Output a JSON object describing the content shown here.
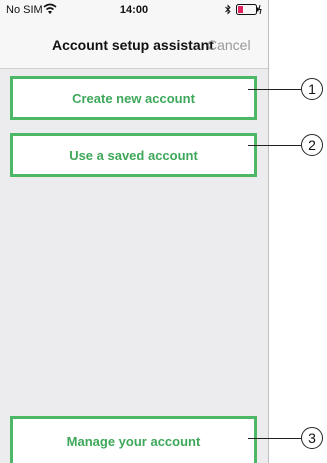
{
  "status_bar": {
    "carrier": "No SIM",
    "time": "14:00"
  },
  "nav_bar": {
    "title": "Account setup assistant",
    "cancel_label": "Cancel"
  },
  "buttons": {
    "create": "Create new account",
    "saved": "Use a saved account",
    "manage": "Manage your account"
  },
  "callouts": [
    "1",
    "2",
    "3"
  ],
  "colors": {
    "accent_green": "#4cb866",
    "button_text_green": "#3ea85a",
    "cancel_gray": "#9a9a9a",
    "background": "#ececee"
  },
  "icons": [
    "wifi-icon",
    "bluetooth-icon",
    "battery-icon"
  ]
}
